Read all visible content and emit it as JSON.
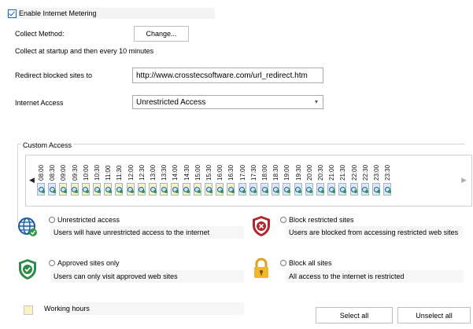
{
  "enable_metering": {
    "label": "Enable Internet Metering",
    "checked": true
  },
  "collect": {
    "label": "Collect Method:",
    "change_button": "Change...",
    "note": "Collect at startup and then every 10 minutes"
  },
  "redirect": {
    "label": "Redirect blocked sites to",
    "value": "http://www.crosstecsoftware.com/url_redirect.htm"
  },
  "internet_access": {
    "label": "Internet Access",
    "value": "Unrestricted Access"
  },
  "custom_access": {
    "legend": "Custom Access",
    "times": [
      "08:00",
      "08:30",
      "09:00",
      "09:30",
      "10:00",
      "10:30",
      "11:00",
      "11:30",
      "12:00",
      "12:30",
      "13:00",
      "13:30",
      "14:00",
      "14:30",
      "15:00",
      "15:30",
      "16:00",
      "16:30",
      "17:00",
      "17:30",
      "18:00",
      "18:30",
      "19:00",
      "19:30",
      "20:00",
      "20:30",
      "21:00",
      "21:30",
      "22:00",
      "22:30",
      "23:00",
      "23:30"
    ],
    "working_slots": [
      "09:00",
      "09:30",
      "10:00",
      "10:30",
      "11:00",
      "11:30",
      "12:00",
      "12:30",
      "13:00",
      "13:30",
      "14:00",
      "14:30",
      "15:00",
      "15:30",
      "16:00",
      "16:30"
    ]
  },
  "options": {
    "unrestricted": {
      "label": "Unrestricted access",
      "desc": "Users will have unrestricted access to the internet",
      "icon": "globe-icon"
    },
    "block_restricted": {
      "label": "Block restricted sites",
      "desc": "Users are blocked from accessing restricted web sites",
      "icon": "shield-block-icon"
    },
    "approved": {
      "label": "Approved sites only",
      "desc": "Users can only visit approved web sites",
      "icon": "shield-check-icon"
    },
    "block_all": {
      "label": "Block all sites",
      "desc": "All access to the internet is restricted",
      "icon": "padlock-icon"
    }
  },
  "legend": {
    "working_hours": "Working hours"
  },
  "buttons": {
    "select_all": "Select all",
    "unselect_all": "Unselect all"
  },
  "colors": {
    "working_hours": "#fbf2c0",
    "normal_slot": "#dde8f2",
    "accent": "#1e66c8"
  }
}
